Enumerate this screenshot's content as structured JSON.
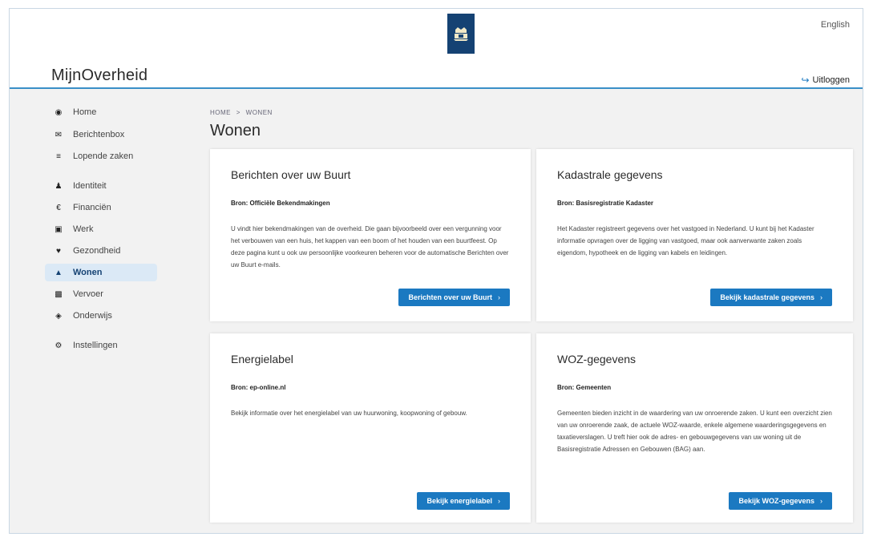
{
  "header": {
    "language_link": "English",
    "brand": "MijnOverheid",
    "logout_label": "Uitloggen"
  },
  "sidebar": {
    "items": [
      {
        "label": "Home",
        "icon": "home-icon"
      },
      {
        "label": "Berichtenbox",
        "icon": "envelope-icon"
      },
      {
        "label": "Lopende zaken",
        "icon": "stack-icon"
      },
      {
        "label": "Identiteit",
        "icon": "person-icon"
      },
      {
        "label": "Financiën",
        "icon": "euro-icon"
      },
      {
        "label": "Werk",
        "icon": "briefcase-icon"
      },
      {
        "label": "Gezondheid",
        "icon": "heart-icon"
      },
      {
        "label": "Wonen",
        "icon": "house-icon",
        "active": true
      },
      {
        "label": "Vervoer",
        "icon": "car-icon"
      },
      {
        "label": "Onderwijs",
        "icon": "graduation-cap-icon"
      },
      {
        "label": "Instellingen",
        "icon": "gear-icon"
      }
    ]
  },
  "breadcrumb": {
    "home": "HOME",
    "separator": ">",
    "current": "WONEN"
  },
  "page_title": "Wonen",
  "cards": [
    {
      "title": "Berichten over uw Buurt",
      "source": "Bron: Officiële Bekendmakingen",
      "text": "U vindt hier bekendmakingen van de overheid. Die gaan bijvoorbeeld over een vergunning voor het verbouwen van een huis, het kappen van een boom of het houden van een buurtfeest. Op deze pagina kunt u ook uw persoonlijke voorkeuren beheren voor de automatische Berichten over uw Buurt e-mails.",
      "button": "Berichten over uw Buurt"
    },
    {
      "title": "Kadastrale gegevens",
      "source": "Bron: Basisregistratie Kadaster",
      "text": "Het Kadaster registreert gegevens over het vastgoed in Nederland. U kunt bij het Kadaster informatie opvragen over de ligging van vastgoed, maar ook aanverwante zaken zoals eigendom, hypotheek en de ligging van kabels en leidingen.",
      "button": "Bekijk kadastrale gegevens"
    },
    {
      "title": "Energielabel",
      "source": "Bron: ep-online.nl",
      "text": "Bekijk informatie over het energielabel van uw huurwoning, koopwoning of gebouw.",
      "button": "Bekijk energielabel"
    },
    {
      "title": "WOZ-gegevens",
      "source": "Bron: Gemeenten",
      "text": "Gemeenten bieden inzicht in de waardering van uw onroerende zaken. U kunt een overzicht zien van uw onroerende zaak, de actuele WOZ-waarde, enkele algemene waarderingsgegevens en taxatieverslagen. U treft hier ook de adres- en gebouwgegevens van uw woning uit de Basisregistratie Adressen en Gebouwen (BAG) aan.",
      "button": "Bekijk WOZ-gegevens"
    }
  ],
  "colors": {
    "accent": "#1b79c1",
    "brand_blue": "#154273",
    "active_nav_bg": "#dbe9f6",
    "header_line": "#3a8fc7"
  }
}
